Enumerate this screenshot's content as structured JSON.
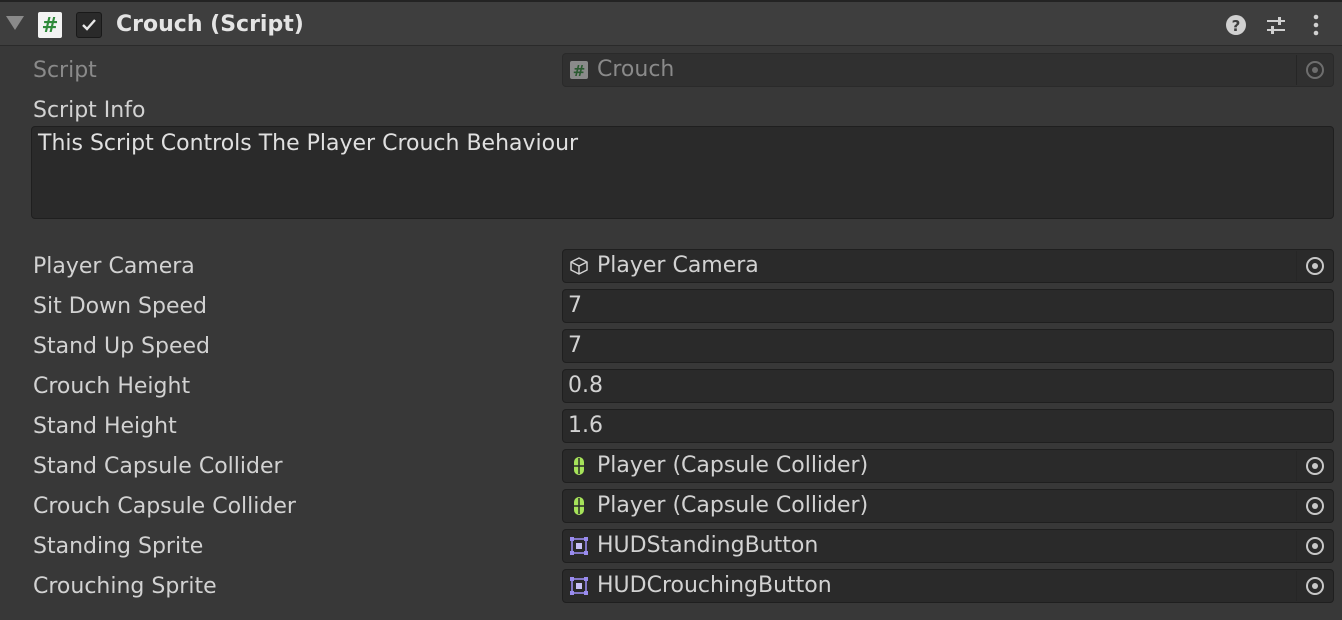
{
  "component": {
    "title": "Crouch (Script)",
    "enabled": true
  },
  "icons": {
    "foldout": "foldout-arrow-icon",
    "script": "script-hash-icon",
    "help": "help-icon",
    "presets": "presets-sliders-icon",
    "menu": "kebab-menu-icon"
  },
  "script_field": {
    "label": "Script",
    "value": "Crouch"
  },
  "script_info": {
    "label": "Script Info",
    "text": "This Script Controls The Player Crouch Behaviour"
  },
  "fields": {
    "player_camera": {
      "label": "Player Camera",
      "value": "Player Camera",
      "icon": "gameobject-cube-icon"
    },
    "sit_down_speed": {
      "label": "Sit Down Speed",
      "value": "7"
    },
    "stand_up_speed": {
      "label": "Stand Up Speed",
      "value": "7"
    },
    "crouch_height": {
      "label": "Crouch Height",
      "value": "0.8"
    },
    "stand_height": {
      "label": "Stand Height",
      "value": "1.6"
    },
    "stand_capsule_collider": {
      "label": "Stand Capsule Collider",
      "value": "Player (Capsule Collider)",
      "icon": "capsule-collider-icon"
    },
    "crouch_capsule_collider": {
      "label": "Crouch Capsule Collider",
      "value": "Player (Capsule Collider)",
      "icon": "capsule-collider-icon"
    },
    "standing_sprite": {
      "label": "Standing Sprite",
      "value": "HUDStandingButton",
      "icon": "sprite-icon"
    },
    "crouching_sprite": {
      "label": "Crouching Sprite",
      "value": "HUDCrouchingButton",
      "icon": "sprite-icon"
    }
  },
  "colors": {
    "background": "#383838",
    "field_bg": "#2a2a2a",
    "collider_green": "#a6e35a",
    "sprite_purple": "#9a8cf0",
    "script_green": "#2f8a3a"
  }
}
